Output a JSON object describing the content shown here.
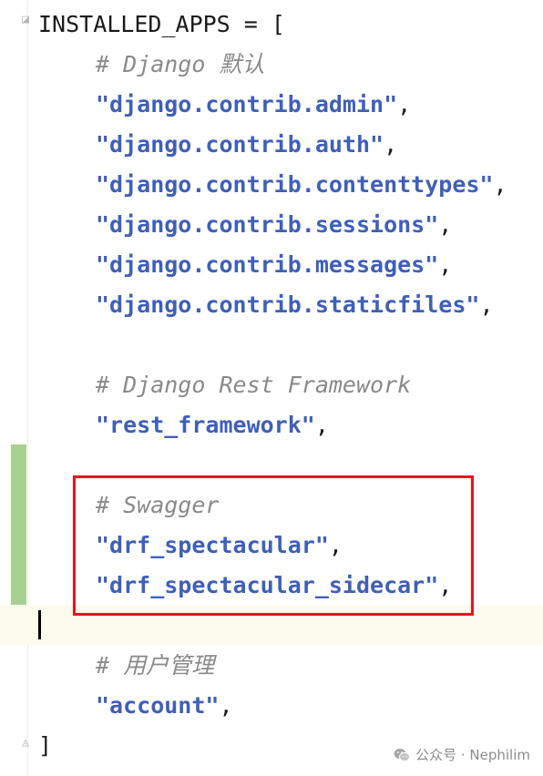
{
  "editor": {
    "line1_name": "INSTALLED_APPS",
    "line1_op": " = [",
    "comment_django": "# Django 默认",
    "django_apps": [
      "\"django.contrib.admin\"",
      "\"django.contrib.auth\"",
      "\"django.contrib.contenttypes\"",
      "\"django.contrib.sessions\"",
      "\"django.contrib.messages\"",
      "\"django.contrib.staticfiles\""
    ],
    "comma": ",",
    "comment_drf": "# Django Rest Framework",
    "rest_framework": "\"rest_framework\"",
    "comment_swagger": "# Swagger",
    "swagger_apps": [
      "\"drf_spectacular\"",
      "\"drf_spectacular_sidecar\""
    ],
    "comment_user": "# 用户管理",
    "account": "\"account\"",
    "closing": "]"
  },
  "colors": {
    "string": "#3f5fb8",
    "comment": "#8a8a8a",
    "change_bar": "#a6d18f",
    "highlight_border": "#e8141c"
  },
  "watermark": {
    "text": "公众号 · Nephilim",
    "icon": "wechat-icon"
  }
}
